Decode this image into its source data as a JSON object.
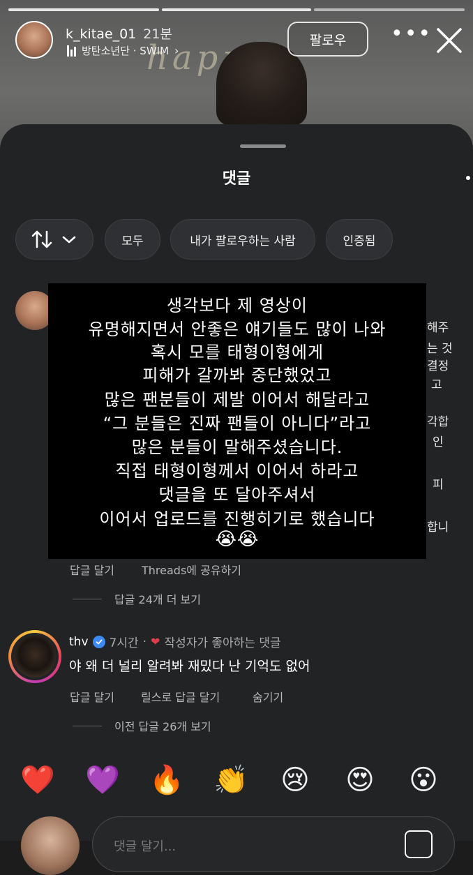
{
  "story": {
    "username": "k_kitae_01",
    "time": "21분",
    "music": "방탄소년단 · SWIM",
    "follow_label": "팔로우",
    "wall_text": "happy"
  },
  "sheet": {
    "title": "댓글",
    "filters": [
      "모두",
      "내가 팔로우하는 사람",
      "인증됨"
    ]
  },
  "overlay_lines": [
    "생각보다 제 영상이",
    "유명해지면서 안좋은 얘기들도 많이 나와",
    "혹시 모를 태형이형에게",
    "피해가 갈까봐 중단했었고",
    "많은 팬분들이 제발 이어서 해달라고",
    "“그 분들은 진짜 팬들이 아니다”라고",
    "많은 분들이 말해주셨습니다.",
    "직접 태형이형께서 이어서 하라고",
    "댓글을 또 달아주셔서",
    "이어서 업로드를 진행히기로 했습니다",
    "😭😭"
  ],
  "hidden_fragments": [
    "해주",
    "는 것",
    "결정",
    "고",
    "각합",
    "인",
    "피",
    "합니"
  ],
  "comment1": {
    "reply_label": "답글 달기",
    "share_label": "Threads에 공유하기",
    "view_more": "답글 24개 더 보기"
  },
  "comment2": {
    "username": "thv",
    "time": "7시간",
    "liked_by_author": "작성자가 좋아하는 댓글",
    "text": "야 왜 더 널리 알려봐 재밌다 난 기억도 없어",
    "reply_label": "답글 달기",
    "reels_reply_label": "릴스로 답글 달기",
    "hide_label": "숨기기",
    "view_prev": "이전 답글 26개 보기"
  },
  "reactions": [
    "❤️",
    "💜",
    "🔥",
    "👏",
    "😢",
    "😍",
    "😮"
  ],
  "input": {
    "placeholder": "댓글 달기..."
  }
}
